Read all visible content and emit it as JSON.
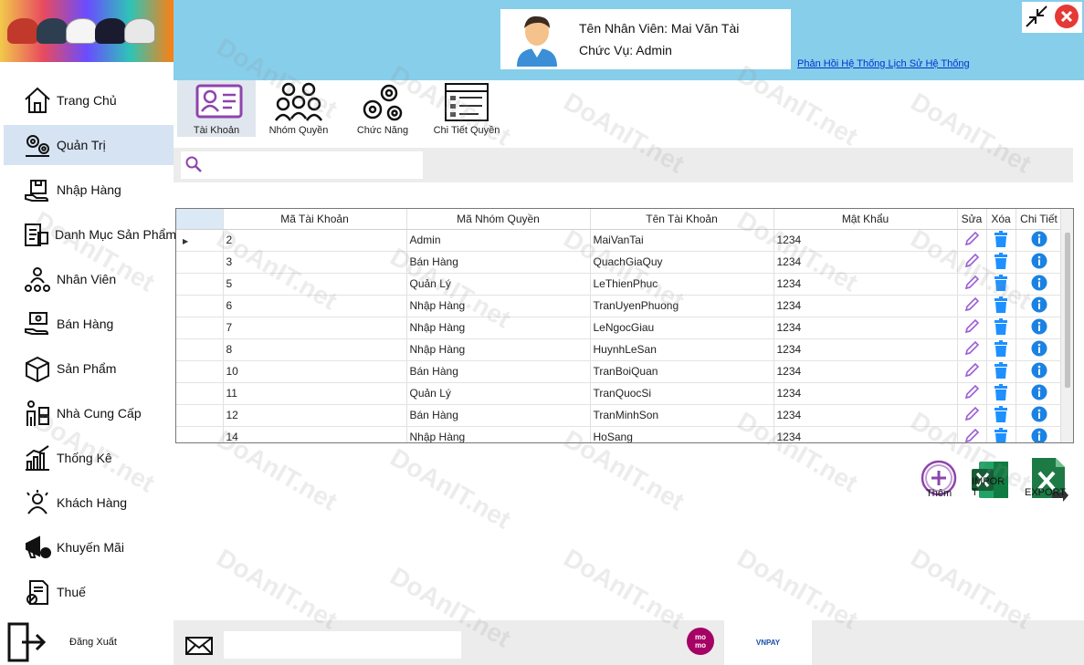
{
  "colors": {
    "header_bg": "#87ceeb",
    "active_menu_bg": "#d6e3f2",
    "edit_icon": "#9a5fd6",
    "delete_icon": "#1e90ff",
    "info_icon": "#1a82e2",
    "excel_green": "#1d7a45",
    "momo": "#a50064"
  },
  "header": {
    "user_name_line": "Tên Nhân Viên: Mai Văn Tài",
    "role_line": "Chức Vụ: Admin",
    "history_link": "Phản Hồi Hệ Thống Lịch Sử Hệ Thống"
  },
  "sidebar": {
    "items": [
      {
        "label": "Trang Chủ",
        "icon": "home-icon"
      },
      {
        "label": "Quản Trị",
        "icon": "gears-icon"
      },
      {
        "label": "Nhập Hàng",
        "icon": "import-box-icon"
      },
      {
        "label": "Danh Mục Sản Phẩm",
        "icon": "catalog-icon"
      },
      {
        "label": "Nhân Viên",
        "icon": "staff-icon"
      },
      {
        "label": "Bán Hàng",
        "icon": "sales-icon"
      },
      {
        "label": "Sản Phẩm",
        "icon": "product-box-icon"
      },
      {
        "label": "Nhà Cung Cấp",
        "icon": "supplier-icon"
      },
      {
        "label": "Thống Kê",
        "icon": "stats-icon"
      },
      {
        "label": "Khách Hàng",
        "icon": "customers-icon"
      },
      {
        "label": "Khuyến Mãi",
        "icon": "promotion-icon"
      },
      {
        "label": "Thuế",
        "icon": "tax-icon"
      }
    ],
    "logout_label": "Đăng Xuất"
  },
  "tabs": [
    {
      "label": "Tài Khoản",
      "icon": "account-card-icon"
    },
    {
      "label": "Nhóm Quyền",
      "icon": "group-icon"
    },
    {
      "label": "Chức Năng",
      "icon": "gears-icon"
    },
    {
      "label": "Chi Tiết Quyền",
      "icon": "permission-list-icon"
    }
  ],
  "search": {
    "placeholder": ""
  },
  "table": {
    "columns": [
      "Mã Tài Khoản",
      "Mã Nhóm Quyền",
      "Tên Tài Khoản",
      "Mật Khẩu",
      "Sửa",
      "Xóa",
      "Chi Tiết"
    ],
    "rows": [
      [
        "2",
        "Admin",
        "MaiVanTai",
        "1234"
      ],
      [
        "3",
        "Bán Hàng",
        "QuachGiaQuy",
        "1234"
      ],
      [
        "5",
        "Quản Lý",
        "LeThienPhuc",
        "1234"
      ],
      [
        "6",
        "Nhập Hàng",
        "TranUyenPhuong",
        "1234"
      ],
      [
        "7",
        "Nhập Hàng",
        "LeNgocGiau",
        "1234"
      ],
      [
        "8",
        "Nhập Hàng",
        "HuynhLeSan",
        "1234"
      ],
      [
        "10",
        "Bán Hàng",
        "TranBoiQuan",
        "1234"
      ],
      [
        "11",
        "Quản Lý",
        "TranQuocSi",
        "1234"
      ],
      [
        "12",
        "Bán Hàng",
        "TranMinhSon",
        "1234"
      ],
      [
        "14",
        "Nhập Hàng",
        "HoSang",
        "1234"
      ]
    ]
  },
  "actions": {
    "add_label": "Thêm",
    "import_label": "IMPOR\nT",
    "export_label": "EXPORT"
  },
  "footer": {
    "message_placeholder": "",
    "momo_text_top": "mo",
    "momo_text_bottom": "mo",
    "vnpay_text": "VNPAY"
  },
  "watermark": "DoAnIT.net"
}
